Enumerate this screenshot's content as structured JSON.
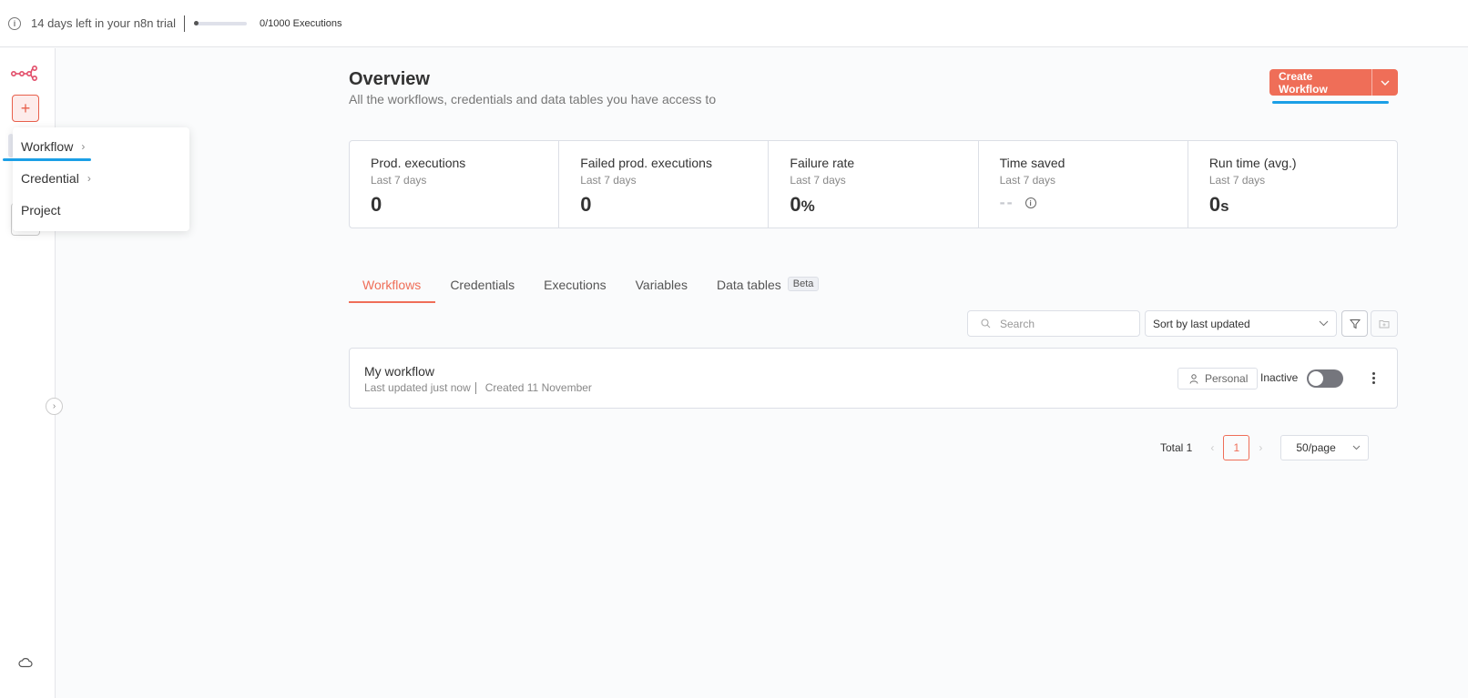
{
  "banner": {
    "trial_text": "14 days left in your n8n trial",
    "executions_text": "0/1000 Executions",
    "executions_used": 0,
    "executions_limit": 1000
  },
  "sidebar": {
    "add_label": "+"
  },
  "create_menu": {
    "items": [
      {
        "label": "Workflow",
        "has_submenu": true
      },
      {
        "label": "Credential",
        "has_submenu": true
      },
      {
        "label": "Project",
        "has_submenu": false
      }
    ]
  },
  "header": {
    "title": "Overview",
    "subtitle": "All the workflows, credentials and data tables you have access to",
    "create_button": "Create Workflow"
  },
  "stats": [
    {
      "label": "Prod. executions",
      "period": "Last 7 days",
      "value": "0"
    },
    {
      "label": "Failed prod. executions",
      "period": "Last 7 days",
      "value": "0"
    },
    {
      "label": "Failure rate",
      "period": "Last 7 days",
      "value": "0",
      "unit": "%"
    },
    {
      "label": "Time saved",
      "period": "Last 7 days",
      "value": "--"
    },
    {
      "label": "Run time (avg.)",
      "period": "Last 7 days",
      "value": "0",
      "unit": "s"
    }
  ],
  "tabs": [
    {
      "label": "Workflows",
      "active": true
    },
    {
      "label": "Credentials"
    },
    {
      "label": "Executions"
    },
    {
      "label": "Variables"
    },
    {
      "label": "Data tables",
      "badge": "Beta"
    }
  ],
  "toolbar": {
    "search_placeholder": "Search",
    "sort_value": "Sort by last updated"
  },
  "workflows": [
    {
      "name": "My workflow",
      "updated": "Last updated just now",
      "created": "Created 11 November",
      "owner": "Personal",
      "status": "Inactive",
      "active": false
    }
  ],
  "pagination": {
    "total": "Total 1",
    "current_page": "1",
    "page_size": "50/page"
  },
  "colors": {
    "accent": "#ef6e58",
    "highlight_underline": "#1b9fe6"
  }
}
